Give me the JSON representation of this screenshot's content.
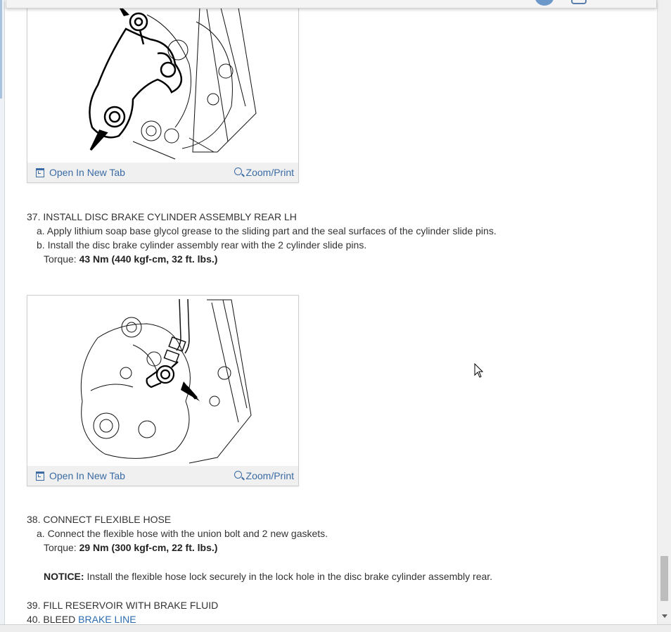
{
  "figures": [
    {
      "open_label": "Open In New Tab",
      "zoom_label": "Zoom/Print"
    },
    {
      "open_label": "Open In New Tab",
      "zoom_label": "Zoom/Print"
    }
  ],
  "steps": {
    "s37": {
      "title": "37. INSTALL DISC BRAKE CYLINDER ASSEMBLY REAR LH",
      "a": "a. Apply lithium soap base glycol grease to the sliding part and the seal surfaces of the cylinder slide pins.",
      "b": "b. Install the disc brake cylinder assembly rear with the 2 cylinder slide pins.",
      "torque_label": "Torque:",
      "torque_value": "43 Nm (440 kgf-cm, 32 ft. lbs.)"
    },
    "s38": {
      "title": "38. CONNECT FLEXIBLE HOSE",
      "a": "a. Connect the flexible hose with the union bolt and 2 new gaskets.",
      "torque_label": "Torque:",
      "torque_value": "29 Nm (300 kgf-cm, 22 ft. lbs.)",
      "notice_label": "NOTICE:",
      "notice_text": "Install the flexible hose lock securely in the lock hole in the disc brake cylinder assembly rear."
    },
    "s39": {
      "title": "39. FILL RESERVOIR WITH BRAKE FLUID"
    },
    "s40": {
      "title_prefix": "40. BLEED",
      "link": "BRAKE LINE"
    }
  },
  "colors": {
    "link": "#2b6cb0",
    "footer_bg": "#f0f0f0",
    "text": "#333333"
  }
}
